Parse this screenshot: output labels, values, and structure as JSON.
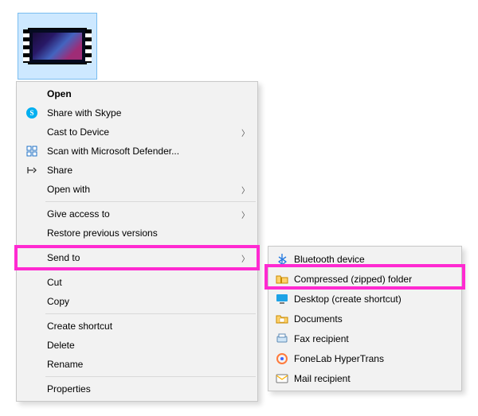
{
  "file": {
    "selected": true
  },
  "menu": {
    "open": "Open",
    "share_skype": "Share with Skype",
    "cast": "Cast to Device",
    "scan_defender": "Scan with Microsoft Defender...",
    "share": "Share",
    "open_with": "Open with",
    "give_access": "Give access to",
    "restore_prev": "Restore previous versions",
    "send_to": "Send to",
    "cut": "Cut",
    "copy": "Copy",
    "create_shortcut": "Create shortcut",
    "delete": "Delete",
    "rename": "Rename",
    "properties": "Properties"
  },
  "submenu": {
    "bluetooth": "Bluetooth device",
    "zip": "Compressed (zipped) folder",
    "desktop_shortcut": "Desktop (create shortcut)",
    "documents": "Documents",
    "fax": "Fax recipient",
    "fonelab": "FoneLab HyperTrans",
    "mail": "Mail recipient"
  }
}
